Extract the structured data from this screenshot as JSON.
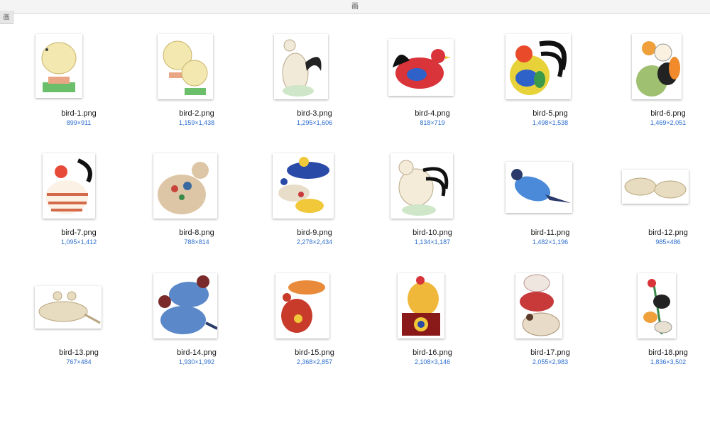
{
  "window": {
    "title": "画"
  },
  "toolbar": {
    "side_label": "画"
  },
  "files": [
    {
      "name": "bird-1.png",
      "dims": "899×911",
      "icon": "chick-on-stand"
    },
    {
      "name": "bird-2.png",
      "dims": "1,159×1,438",
      "icon": "two-chicks"
    },
    {
      "name": "bird-3.png",
      "dims": "1,295×1,606",
      "icon": "white-hen"
    },
    {
      "name": "bird-4.png",
      "dims": "818×719",
      "icon": "red-rooster"
    },
    {
      "name": "bird-5.png",
      "dims": "1,498×1,538",
      "icon": "rooster-black-tail"
    },
    {
      "name": "bird-6.png",
      "dims": "1,469×2,051",
      "icon": "doll-with-chick"
    },
    {
      "name": "bird-7.png",
      "dims": "1,095×1,412",
      "icon": "round-bird-stripes"
    },
    {
      "name": "bird-8.png",
      "dims": "788×814",
      "icon": "quail"
    },
    {
      "name": "bird-9.png",
      "dims": "2,278×2,434",
      "icon": "bird-group"
    },
    {
      "name": "bird-10.png",
      "dims": "1,134×1,187",
      "icon": "hen-striped-tail"
    },
    {
      "name": "bird-11.png",
      "dims": "1,482×1,196",
      "icon": "blue-bird"
    },
    {
      "name": "bird-12.png",
      "dims": "985×486",
      "icon": "two-doves"
    },
    {
      "name": "bird-13.png",
      "dims": "767×484",
      "icon": "dove-pair"
    },
    {
      "name": "bird-14.png",
      "dims": "1,930×1,992",
      "icon": "blue-birds-stack"
    },
    {
      "name": "bird-15.png",
      "dims": "2,368×2,857",
      "icon": "red-birds"
    },
    {
      "name": "bird-16.png",
      "dims": "2,108×3,146",
      "icon": "rooster-on-box"
    },
    {
      "name": "bird-17.png",
      "dims": "2,055×2,983",
      "icon": "stacked-birds"
    },
    {
      "name": "bird-18.png",
      "dims": "1,836×3,502",
      "icon": "bird-on-pole"
    }
  ]
}
